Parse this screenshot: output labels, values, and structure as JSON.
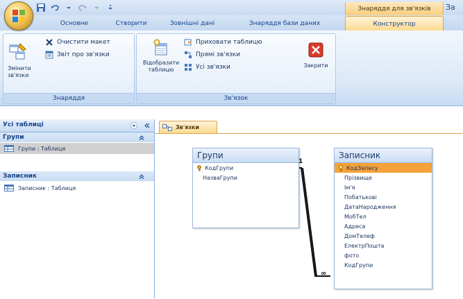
{
  "titlebar": {
    "context_tools": "Знаряддя для зв'язків",
    "title_tail": "За"
  },
  "tabs": [
    {
      "label": "Основне"
    },
    {
      "label": "Створити"
    },
    {
      "label": "Зовнішні дані"
    },
    {
      "label": "Знаряддя бази даних"
    }
  ],
  "context_tab": {
    "label": "Конструктор"
  },
  "ribbon": {
    "tools_group": {
      "label": "Знаряддя",
      "edit_relations": "Змінити\nзв'язки",
      "clear_layout": "Очистити макет",
      "relations_report": "Звіт про зв'язки"
    },
    "relation_group": {
      "label": "Зв'язок",
      "show_table": "Відобразити\nтаблицю",
      "hide_table": "Приховати таблицю",
      "direct_relations": "Прямі зв'язки",
      "all_relations": "Усі зв'язки",
      "close": "Закрити"
    }
  },
  "nav": {
    "header": "Усі таблиці",
    "groups": [
      {
        "name": "Групи",
        "item": "Групи : Таблиця"
      },
      {
        "name": "Записник",
        "item": "Записник : Таблиця"
      }
    ]
  },
  "document": {
    "tab_label": "Зв'язки"
  },
  "tables": {
    "groups_table": {
      "title": "Групи",
      "fields": [
        "КодГрупи",
        "НазваГрупи"
      ]
    },
    "notebook_table": {
      "title": "Записник",
      "fields": [
        "КодЗапису",
        "Прізвище",
        "Ім'я",
        "Побатькові",
        "ДатаНародження",
        "МобТел",
        "Адреса",
        "ДомТелеф",
        "ЕлектрПошта",
        "фото",
        "КодГрупи"
      ]
    }
  },
  "relation": {
    "one_label": "1",
    "many_label": "∞"
  },
  "colors": {
    "accent_orange": "#f6a23a",
    "ribbon_blue": "#c6daf2",
    "text_blue": "#15428b"
  }
}
